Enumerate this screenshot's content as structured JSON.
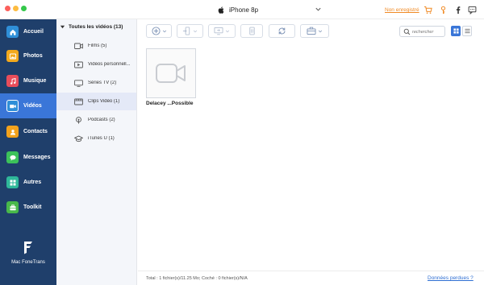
{
  "titlebar": {
    "device_name": "iPhone 8p",
    "register_label": "Non enregistré"
  },
  "sidebar": {
    "items": [
      {
        "label": "Accueil",
        "icon": "home-icon",
        "color": "#2f8fd8"
      },
      {
        "label": "Photos",
        "icon": "photos-icon",
        "color": "#f2a91d"
      },
      {
        "label": "Musique",
        "icon": "music-icon",
        "color": "#e84d5b"
      },
      {
        "label": "Vidéos",
        "icon": "video-icon",
        "color": "#2f8fd8"
      },
      {
        "label": "Contacts",
        "icon": "contacts-icon",
        "color": "#f2a21d"
      },
      {
        "label": "Messages",
        "icon": "messages-icon",
        "color": "#3cc25a"
      },
      {
        "label": "Autres",
        "icon": "others-icon",
        "color": "#2fb89a"
      },
      {
        "label": "Toolkit",
        "icon": "toolkit-icon",
        "color": "#48b84a"
      }
    ],
    "active_index": 3,
    "brand_name": "Mac FoneTrans"
  },
  "categories": {
    "header": "Toutes les vidéos (13)",
    "items": [
      {
        "label": "Films (5)",
        "icon": "film-icon"
      },
      {
        "label": "Vidéos personnell...",
        "icon": "personal-video-icon"
      },
      {
        "label": "Séries TV (2)",
        "icon": "tv-icon"
      },
      {
        "label": "Clips Vidéo (1)",
        "icon": "clip-icon"
      },
      {
        "label": "Podcasts (2)",
        "icon": "podcast-icon"
      },
      {
        "label": "iTunes U (1)",
        "icon": "itunes-u-icon"
      }
    ],
    "active_index": 3
  },
  "toolbar": {
    "search_placeholder": "rechercher"
  },
  "content": {
    "videos": [
      {
        "title": "Delacey ...Possible"
      }
    ]
  },
  "status": {
    "summary": "Total : 1 fichier(s)/11.25 Mo; Coché : 0 fichier(s)/N/A",
    "lost_data_link": "Données perdues ?"
  },
  "colors": {
    "sidebar_bg": "#1f3f6b",
    "active_nav": "#3a76d8",
    "accent_orange": "#f08a24",
    "link_blue": "#2f6fd3"
  }
}
